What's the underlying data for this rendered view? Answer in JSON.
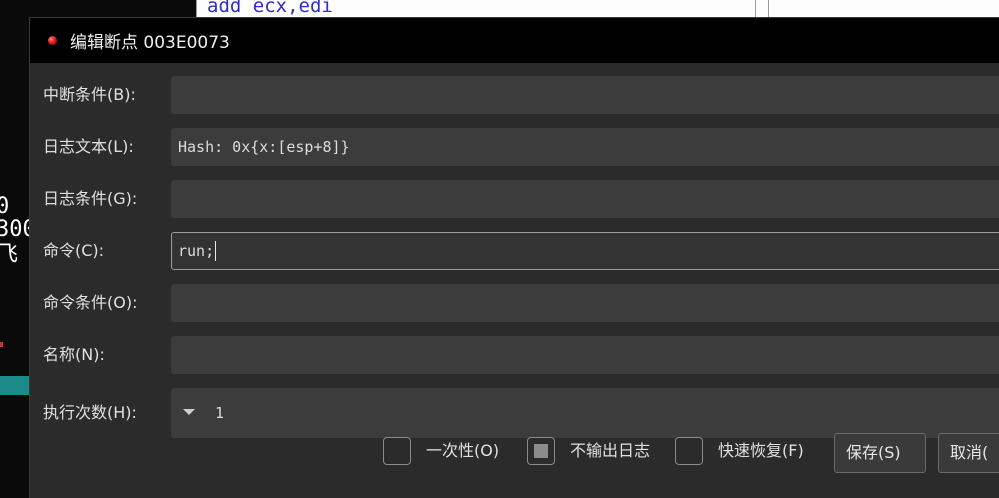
{
  "background": {
    "code_line": "add ecx,edi",
    "left_fragments": [
      "0",
      "300",
      "飞"
    ]
  },
  "dialog": {
    "title": "编辑断点 003E0073",
    "fields": {
      "break_condition": {
        "label": "中断条件(B):",
        "value": ""
      },
      "log_text": {
        "label": "日志文本(L):",
        "value": "Hash: 0x{x:[esp+8]}"
      },
      "log_condition": {
        "label": "日志条件(G):",
        "value": ""
      },
      "command": {
        "label": "命令(C):",
        "value": "run;"
      },
      "command_condition": {
        "label": "命令条件(O):",
        "value": ""
      },
      "name": {
        "label": "名称(N):",
        "value": ""
      },
      "hit_count": {
        "label": "执行次数(H):",
        "value": "1"
      }
    },
    "options": {
      "singleshot": {
        "label": "一次性(O)",
        "checked": false
      },
      "silent": {
        "label": "不输出日志",
        "checked": "indeterminate"
      },
      "fast_resume": {
        "label": "快速恢复(F)",
        "checked": false
      }
    },
    "buttons": {
      "save": "保存(S)",
      "cancel": "取消("
    }
  },
  "colors": {
    "dialog_bg": "#2b2b2b",
    "titlebar_bg": "#000000",
    "input_bg": "#3c3c3c",
    "breakpoint_icon": "#e01818",
    "code_text": "#2f2bd1",
    "teal_highlight": "#1d8a8a"
  },
  "icons": {
    "title_icon": "breakpoint-dot-icon",
    "spin_icon": "chevron-down-icon"
  }
}
